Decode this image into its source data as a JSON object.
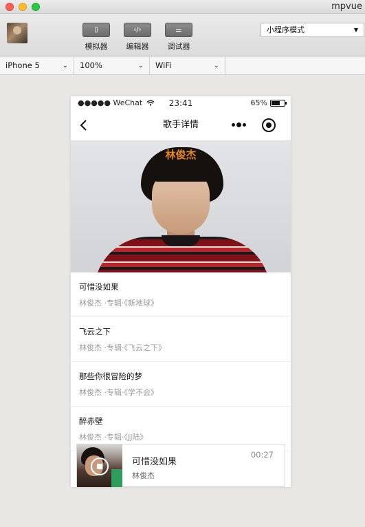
{
  "window": {
    "title": "mpvue"
  },
  "toolbar": {
    "simulator_label": "模拟器",
    "editor_label": "编辑器",
    "debugger_label": "调试器",
    "simulator_glyph": "▯",
    "editor_glyph": "‹/›",
    "debugger_glyph": "⚌",
    "mode_select": "小程序模式"
  },
  "device_bar": {
    "device": "iPhone 5",
    "zoom": "100%",
    "network": "WiFi"
  },
  "phone": {
    "status": {
      "carrier": "●●●●● WeChat",
      "time": "23:41",
      "battery": "65%",
      "battery_level": 0.65
    },
    "nav": {
      "title": "歌手详情"
    },
    "banner": {
      "singer": "林俊杰"
    },
    "songs": [
      {
        "name": "可惜没如果",
        "meta": "林俊杰 ·专辑·《新地球》"
      },
      {
        "name": "飞云之下",
        "meta": "林俊杰 ·专辑·《飞云之下》"
      },
      {
        "name": "那些你很冒险的梦",
        "meta": "林俊杰 ·专辑·《学不会》"
      },
      {
        "name": "醉赤壁",
        "meta": "林俊杰 ·专辑·《JJ陆》"
      }
    ],
    "player": {
      "title": "可惜没如果",
      "artist": "林俊杰",
      "time": "00:27"
    }
  },
  "colors": {
    "accent": "#e5861c",
    "player_border": "#d8d8d8"
  }
}
